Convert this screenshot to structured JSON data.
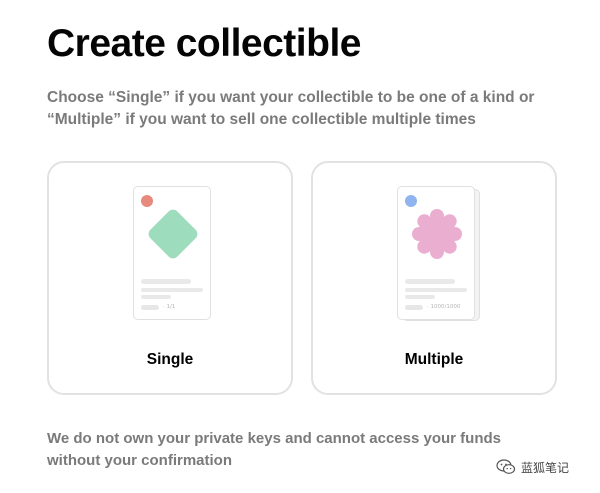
{
  "page": {
    "title": "Create collectible",
    "description": "Choose “Single” if you want your collectible to be one of a kind or “Multiple” if you want to sell one collectible multiple times",
    "footer": "We do not own your private keys and cannot access your funds without your confirmation"
  },
  "options": [
    {
      "label": "Single",
      "edition": "· 1/1",
      "shape_color": "#9ddcbd",
      "dot_color": "#e8897e"
    },
    {
      "label": "Multiple",
      "edition": "· 1000/1000",
      "shape_color": "#eaaed0",
      "dot_color": "#8fb4ef"
    }
  ],
  "watermark": {
    "text": "蓝狐笔记",
    "icon": "wechat-icon"
  },
  "colors": {
    "text_primary": "#050505",
    "text_secondary": "#7a7a7a",
    "card_border": "#e2e2e2"
  }
}
